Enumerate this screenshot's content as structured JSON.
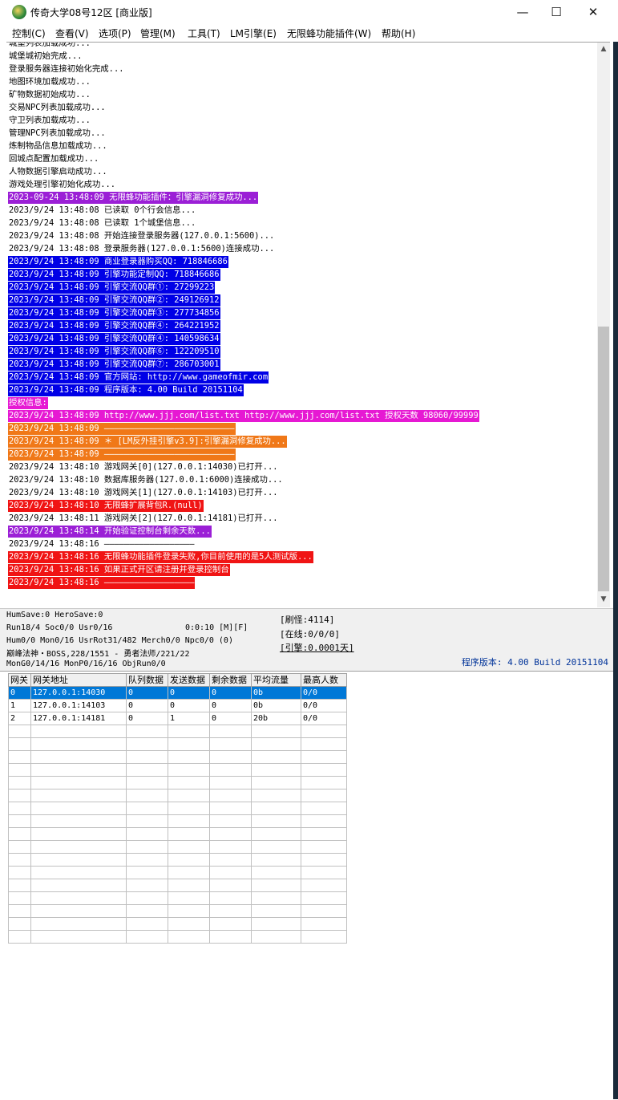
{
  "window": {
    "title": "传奇大学08号12区 [商业版]",
    "minimize": "—",
    "maximize": "☐",
    "close": "✕"
  },
  "menu": [
    {
      "label": "控制(C)"
    },
    {
      "label": "查看(V)"
    },
    {
      "label": "选项(P)"
    },
    {
      "label": "管理(M)"
    },
    {
      "label": "工具(T)"
    },
    {
      "label": "LM引擎(E)"
    },
    {
      "label": "无限蜂功能插件(W)"
    },
    {
      "label": "帮助(H)"
    }
  ],
  "log": [
    {
      "text": "城堡列表加载成功...",
      "bg": "",
      "fg": "#000000"
    },
    {
      "text": "城堡城初始完成...",
      "bg": "",
      "fg": "#000000"
    },
    {
      "text": "登录服务器连接初始化完成...",
      "bg": "",
      "fg": "#000000"
    },
    {
      "text": "地图环境加载成功...",
      "bg": "",
      "fg": "#000000"
    },
    {
      "text": "矿物数据初始成功...",
      "bg": "",
      "fg": "#000000"
    },
    {
      "text": "交易NPC列表加载成功...",
      "bg": "",
      "fg": "#000000"
    },
    {
      "text": "守卫列表加载成功...",
      "bg": "",
      "fg": "#000000"
    },
    {
      "text": "管理NPC列表加载成功...",
      "bg": "",
      "fg": "#000000"
    },
    {
      "text": "炼制物品信息加载成功...",
      "bg": "",
      "fg": "#000000"
    },
    {
      "text": "回城点配置加载成功...",
      "bg": "",
      "fg": "#000000"
    },
    {
      "text": "人物数据引擎启动成功...",
      "bg": "",
      "fg": "#000000"
    },
    {
      "text": "游戏处理引擎初始化成功...",
      "bg": "",
      "fg": "#000000"
    },
    {
      "text": "2023-09-24 13:48:09 无限蜂功能插件：引擎漏洞修复成功...",
      "bg": "#9b1fd6",
      "fg": "#ffffff"
    },
    {
      "text": "2023/9/24 13:48:08 已读取 0个行会信息...",
      "bg": "",
      "fg": "#000000"
    },
    {
      "text": "2023/9/24 13:48:08 已读取 1个城堡信息...",
      "bg": "",
      "fg": "#000000"
    },
    {
      "text": "2023/9/24 13:48:08 开始连接登录服务器(127.0.0.1:5600)...",
      "bg": "",
      "fg": "#000000"
    },
    {
      "text": "2023/9/24 13:48:08 登录服务器(127.0.0.1:5600)连接成功...",
      "bg": "",
      "fg": "#000000"
    },
    {
      "text": "2023/9/24 13:48:09 商业登录器购买QQ: 718846686",
      "bg": "#0000e6",
      "fg": "#ffffff"
    },
    {
      "text": "2023/9/24 13:48:09 引擎功能定制QQ: 718846686",
      "bg": "#0000e6",
      "fg": "#ffffff"
    },
    {
      "text": "2023/9/24 13:48:09 引擎交流QQ群①: 27299223",
      "bg": "#0000e6",
      "fg": "#ffffff"
    },
    {
      "text": "2023/9/24 13:48:09 引擎交流QQ群②: 249126912",
      "bg": "#0000e6",
      "fg": "#ffffff"
    },
    {
      "text": "2023/9/24 13:48:09 引擎交流QQ群③: 277734856",
      "bg": "#0000e6",
      "fg": "#ffffff"
    },
    {
      "text": "2023/9/24 13:48:09 引擎交流QQ群④: 264221952",
      "bg": "#0000e6",
      "fg": "#ffffff"
    },
    {
      "text": "2023/9/24 13:48:09 引擎交流QQ群④: 140598634",
      "bg": "#0000e6",
      "fg": "#ffffff"
    },
    {
      "text": "2023/9/24 13:48:09 引擎交流QQ群⑥: 122209510",
      "bg": "#0000e6",
      "fg": "#ffffff"
    },
    {
      "text": "2023/9/24 13:48:09 引擎交流QQ群⑦: 286703001",
      "bg": "#0000e6",
      "fg": "#ffffff"
    },
    {
      "text": "2023/9/24 13:48:09 官方网站: http://www.gameofmir.com",
      "bg": "#0000e6",
      "fg": "#ffffff"
    },
    {
      "text": "2023/9/24 13:48:09 程序版本: 4.00 Build 20151104",
      "bg": "#0000e6",
      "fg": "#ffffff"
    },
    {
      "text": "授权信息:",
      "bg": "#e619d3",
      "fg": "#ffffff"
    },
    {
      "text": "2023/9/24 13:48:09 http://www.jjj.com/list.txt http://www.jjj.com/list.txt 授权天数 98060/99999",
      "bg": "#e619d3",
      "fg": "#ffffff"
    },
    {
      "text": "2023/9/24 13:48:09 ——————————————————————————",
      "bg": "#f07818",
      "fg": "#ffffff"
    },
    {
      "text": "2023/9/24 13:48:09 ＊ [LM反外挂引擎v3.9]:引擎漏洞修复成功...",
      "bg": "#f07818",
      "fg": "#ffffff"
    },
    {
      "text": "2023/9/24 13:48:09 ——————————————————————————",
      "bg": "#f07818",
      "fg": "#ffffff"
    },
    {
      "text": "2023/9/24 13:48:10 游戏网关[0](127.0.0.1:14030)已打开...",
      "bg": "",
      "fg": "#000000"
    },
    {
      "text": "2023/9/24 13:48:10 数据库服务器(127.0.0.1:6000)连接成功...",
      "bg": "",
      "fg": "#000000"
    },
    {
      "text": "2023/9/24 13:48:10 游戏网关[1](127.0.0.1:14103)已打开...",
      "bg": "",
      "fg": "#000000"
    },
    {
      "text": "2023/9/24 13:48:10 无限蜂扩展背包R.(null)",
      "bg": "#f01414",
      "fg": "#ffffff"
    },
    {
      "text": "2023/9/24 13:48:11 游戏网关[2](127.0.0.1:14181)已打开...",
      "bg": "",
      "fg": "#000000"
    },
    {
      "text": "2023/9/24 13:48:14 开始验证控制台剩余天数...",
      "bg": "#9b1fd6",
      "fg": "#ffffff"
    },
    {
      "text": "2023/9/24 13:48:16 ——————————————————",
      "bg": "",
      "fg": "#000000"
    },
    {
      "text": "2023/9/24 13:48:16 无限蜂功能插件登录失败,你目前使用的是5人测试版...",
      "bg": "#f01414",
      "fg": "#ffffff"
    },
    {
      "text": "2023/9/24 13:48:16 如果正式开区请注册并登录控制台",
      "bg": "#f01414",
      "fg": "#ffffff"
    },
    {
      "text": "2023/9/24 13:48:16 ——————————————————",
      "bg": "#f01414",
      "fg": "#ffffff"
    }
  ],
  "status": {
    "line1": "HumSave:0 HeroSave:0",
    "line2": "Run18/4 Soc0/0 Usr0/16",
    "timer": "0:0:10 [M][F]",
    "line3": "Hum0/0 Mon0/16 UsrRot31/482 Merch0/0 Npc0/0 (0)",
    "line4": "巅峰法神・BOSS,228/1551 - 勇者法师/221/22",
    "line5": "MonG0/14/16 MonP0/16/16 ObjRun0/0",
    "refresh": "[刷怪:4114]",
    "online": "[在线:0/0/0]",
    "engine": "[引擎:0.0001天]",
    "version": "程序版本: 4.00 Build 20151104"
  },
  "grid": {
    "headers": [
      "网关",
      "网关地址",
      "队列数据",
      "发送数据",
      "剩余数据",
      "平均流量",
      "最高人数"
    ],
    "rows": [
      [
        "0",
        "127.0.0.1:14030",
        "0",
        "0",
        "0",
        "0b",
        "0/0"
      ],
      [
        "1",
        "127.0.0.1:14103",
        "0",
        "0",
        "0",
        "0b",
        "0/0"
      ],
      [
        "2",
        "127.0.0.1:14181",
        "0",
        "1",
        "0",
        "20b",
        "0/0"
      ]
    ],
    "empty_rows": 17
  },
  "colors": {
    "purple": "#9b1fd6",
    "blue": "#0000e6",
    "magenta": "#e619d3",
    "orange": "#f07818",
    "red": "#f01414",
    "selection": "#0078d7"
  },
  "icons": {
    "app": "app-icon",
    "scroll_up": "▲",
    "scroll_down": "▼"
  }
}
